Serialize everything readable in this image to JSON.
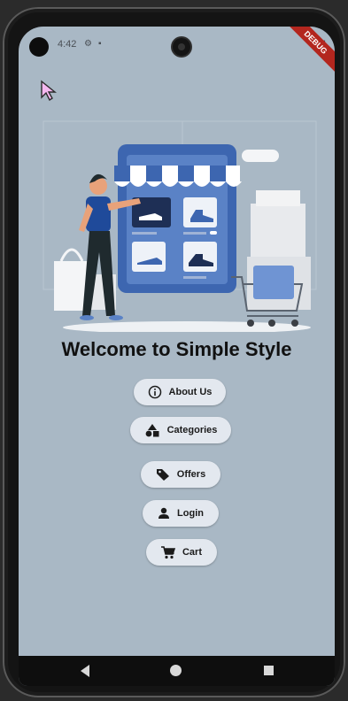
{
  "status": {
    "time": "4:42",
    "debug_banner": "DEBUG"
  },
  "welcome_title": "Welcome to Simple Style",
  "buttons": {
    "about": "About Us",
    "categories": "Categories",
    "offers": "Offers",
    "login": "Login",
    "cart": "Cart"
  },
  "icons": {
    "about": "info-icon",
    "categories": "shapes-icon",
    "offers": "tag-icon",
    "login": "person-icon",
    "cart": "cart-icon"
  },
  "colors": {
    "background": "#a9b8c5",
    "button_bg": "#e3e8ef",
    "accent_blue": "#3d66b0"
  }
}
